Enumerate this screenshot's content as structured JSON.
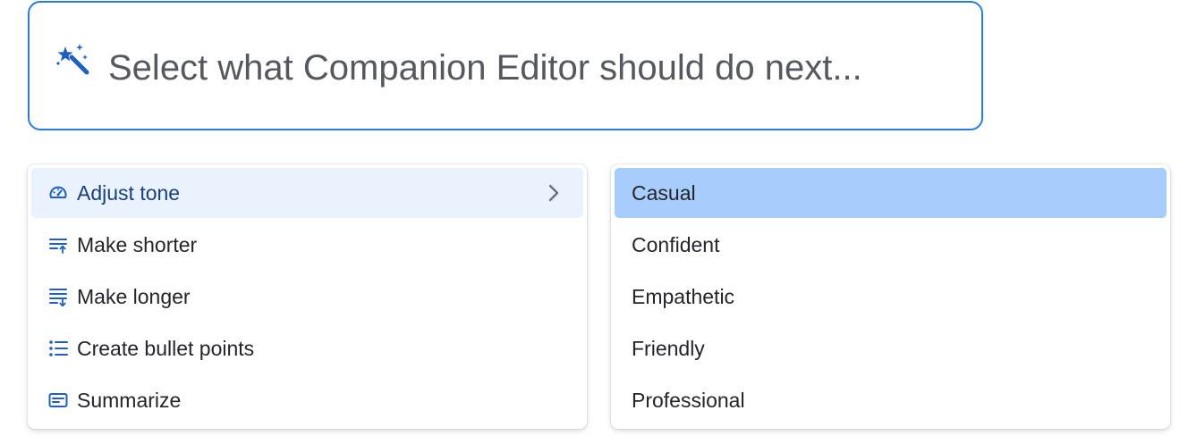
{
  "prompt": {
    "icon": "magic-wand-icon",
    "placeholder": "Select what Companion Editor should do next..."
  },
  "actions_menu": {
    "items": [
      {
        "label": "Adjust tone",
        "icon": "gauge-icon",
        "active": true,
        "has_submenu": true
      },
      {
        "label": "Make shorter",
        "icon": "text-shorten-icon"
      },
      {
        "label": "Make longer",
        "icon": "text-lengthen-icon"
      },
      {
        "label": "Create bullet points",
        "icon": "bullet-list-icon"
      },
      {
        "label": "Summarize",
        "icon": "summary-card-icon"
      }
    ]
  },
  "tone_menu": {
    "items": [
      {
        "label": "Casual",
        "selected": true
      },
      {
        "label": "Confident"
      },
      {
        "label": "Empathetic"
      },
      {
        "label": "Friendly"
      },
      {
        "label": "Professional"
      }
    ]
  },
  "colors": {
    "accent": "#2a7be0",
    "icon_blue": "#1f5fbf",
    "active_bg": "#eaf2fe",
    "selected_bg": "#a8cdfc",
    "placeholder_text": "#55595f"
  }
}
